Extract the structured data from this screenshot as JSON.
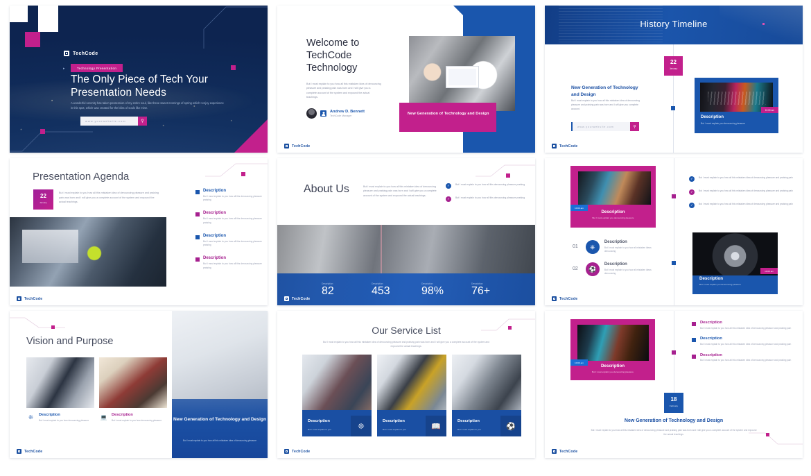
{
  "brand": {
    "name": "TechCode",
    "logo_icon": "chip-square-icon"
  },
  "slides": [
    {
      "id": "title-slide",
      "brand": "TechCode",
      "tag": "Technology Presentation",
      "title": "The Only Piece of Tech Your Presentation Needs",
      "lead": "A wonderful serenity has taken possession of my entire soul, like these sweet mornings of spring which I enjoy experience in this spot, which was created for the bliss of souls like mine.",
      "search": {
        "value": "www.yourwebsite.com",
        "icon": "search-icon"
      }
    },
    {
      "id": "welcome-slide",
      "title": "Welcome to TechCode Technology",
      "body": "But I must explain to you how all this mistaken idea of denouncing pleasure and praising pain was born and I will give you a complete account of the system and expound the actual teachings.",
      "person": {
        "name": "Andrew D. Bennett",
        "role": "TechCode Manager",
        "icon": "user-icon",
        "avatar": "avatar"
      },
      "card_title": "New Generation of Technology and Design",
      "photo_alt": "team-reviewing-tablet-photo"
    },
    {
      "id": "history-timeline-slide",
      "title": "History Timeline",
      "date": {
        "day": "22",
        "month": "January"
      },
      "heading": "New Generation of Technology and Design",
      "body": "But I must explain to you how all this mistaken idea of denouncing pleasure and praising pain was born and I will give you complete account.",
      "search": {
        "value": "www.yourwebsite.com",
        "icon": "search-icon"
      },
      "card": {
        "time": "10:00 am",
        "title": "Description",
        "sub": "But I must explain you denouncing pleasure",
        "photo_alt": "rgb-gaming-keyboard-photo"
      }
    },
    {
      "id": "presentation-agenda-slide",
      "title": "Presentation Agenda",
      "date": {
        "day": "22",
        "month": "January"
      },
      "body": "But I must explain to you how all this mistaken idea of denouncing pleasure and praising pain was born and I will give you a complete account of the system and expound the actual teachings.",
      "photo_alt": "industrial-robotics-machine-photo",
      "items": [
        {
          "title": "Description",
          "text": "But I must explain to you how all this denouncing pleasure praising",
          "color": "blue"
        },
        {
          "title": "Description",
          "text": "But I must explain to you how all this denouncing pleasure praising",
          "color": "magenta"
        },
        {
          "title": "Description",
          "text": "But I must explain to you how all this denouncing pleasure praising",
          "color": "blue"
        },
        {
          "title": "Description",
          "text": "But I must explain to you how all this denouncing pleasure praising",
          "color": "magenta"
        }
      ]
    },
    {
      "id": "about-us-slide",
      "title": "About Us",
      "body": "But I must explain to you how all this mistaken idea of denouncing pleasure and praising pain was born and I will give you a complete account of the system and expound the actual teachings.",
      "checks": [
        {
          "text": "But I must explain to you how all this denouncing pleasure praising",
          "color": "blue",
          "icon": "check-circle-icon"
        },
        {
          "text": "But I must explain to you how all this denouncing pleasure praising",
          "color": "magenta",
          "icon": "check-circle-icon"
        }
      ],
      "photo_alt": "industrial-pipes-machinery-photo",
      "stats": [
        {
          "label": "Description",
          "value": "82"
        },
        {
          "label": "Description",
          "value": "453"
        },
        {
          "label": "Description",
          "value": "98%"
        },
        {
          "label": "Description",
          "value": "76+"
        }
      ]
    },
    {
      "id": "features-split-slide",
      "magenta_card": {
        "time": "10:00 am",
        "title": "Description",
        "sub": "But I must explain you denouncing pleasure",
        "photo_alt": "robotic-arm-photo"
      },
      "blue_card": {
        "time": "10:00 am",
        "title": "Description",
        "sub": "But I must explain you denouncing pleasure",
        "photo_alt": "machine-turbine-photo"
      },
      "numbered": [
        {
          "num": "01",
          "title": "Description",
          "text": "But I must explain to you how all mistaken ideas denouncing",
          "color": "blue",
          "icon": "vr-headset-icon"
        },
        {
          "num": "02",
          "title": "Description",
          "text": "But I must explain to you how all mistaken ideas denouncing",
          "color": "magenta",
          "icon": "drone-icon"
        }
      ],
      "bullets": [
        {
          "text": "But I must explain to you how all this mistaken idea of denouncing pleasure and praising pain",
          "color": "blue",
          "icon": "check-circle-icon"
        },
        {
          "text": "But I must explain to you how all this mistaken idea of denouncing pleasure and praising pain",
          "color": "magenta",
          "icon": "check-circle-icon"
        },
        {
          "text": "But I must explain to you how all this mistaken idea of denouncing pleasure and praising pain",
          "color": "blue",
          "icon": "check-circle-icon"
        }
      ]
    },
    {
      "id": "vision-and-purpose-slide",
      "title": "Vision and Purpose",
      "captions": [
        {
          "title": "Description",
          "text": "But I must explain to you how denouncing pleasure",
          "color": "blue",
          "icon": "network-nodes-icon"
        },
        {
          "title": "Description",
          "text": "But I must explain to you how denouncing pleasure",
          "color": "magenta",
          "icon": "laptop-icon"
        }
      ],
      "photos": [
        "desk-monitors-workspace-photo",
        "man-holding-tablet-photo"
      ],
      "right_panel": {
        "title": "New Generation of Technology and Design",
        "text": "But I must explain to you how all this mistaken idea of denouncing pleasure",
        "photo_alt": "engineer-at-workstation-photo"
      }
    },
    {
      "id": "our-service-list-slide",
      "title": "Our Service List",
      "subtitle": "But I must explain to you how all this mistaken idea of denouncing pleasure and praising pain was born and I will give you a complete account of the system and expound the actual teachings.",
      "cards": [
        {
          "title": "Description",
          "text": "But I must explain to you",
          "icon": "network-nodes-icon",
          "photo_alt": "three-men-discussing-photo"
        },
        {
          "title": "Description",
          "text": "But I must explain to you",
          "icon": "book-icon",
          "photo_alt": "students-with-robot-arms-photo"
        },
        {
          "title": "Description",
          "text": "But I must explain to you",
          "icon": "drone-icon",
          "photo_alt": "woman-engineer-lab-photo"
        }
      ]
    },
    {
      "id": "closing-timeline-slide",
      "card": {
        "time": "10:00 am",
        "title": "Description",
        "sub": "But I must explain you denouncing pleasure",
        "photo_alt": "server-room-equipment-photo"
      },
      "bullets": [
        {
          "title": "Description",
          "text": "But I must explain to you how all this mistaken idea of denouncing pleasure and praising pain",
          "color": "magenta"
        },
        {
          "title": "Description",
          "text": "But I must explain to you how all this mistaken idea of denouncing pleasure and praising pain",
          "color": "blue"
        },
        {
          "title": "Description",
          "text": "But I must explain to you how all this mistaken idea of denouncing pleasure and praising pain",
          "color": "magenta"
        }
      ],
      "date": {
        "day": "18",
        "month": "February"
      },
      "bottom_title": "New Generation of Technology and Design",
      "bottom_text": "But I must explain to you how all this mistaken idea of denouncing pleasure and praising pain was born and I will give you a complete account of the system and expound the actual teachings."
    }
  ],
  "colors": {
    "brand_blue": "#1a4fa3",
    "brand_blue_light": "#1a56ad",
    "magenta": "#c2208c",
    "magenta_dark": "#a6208f",
    "dark_navy": "#0e2a5c",
    "text_gray": "#8f95a9",
    "heading_gray": "#454b5e"
  }
}
